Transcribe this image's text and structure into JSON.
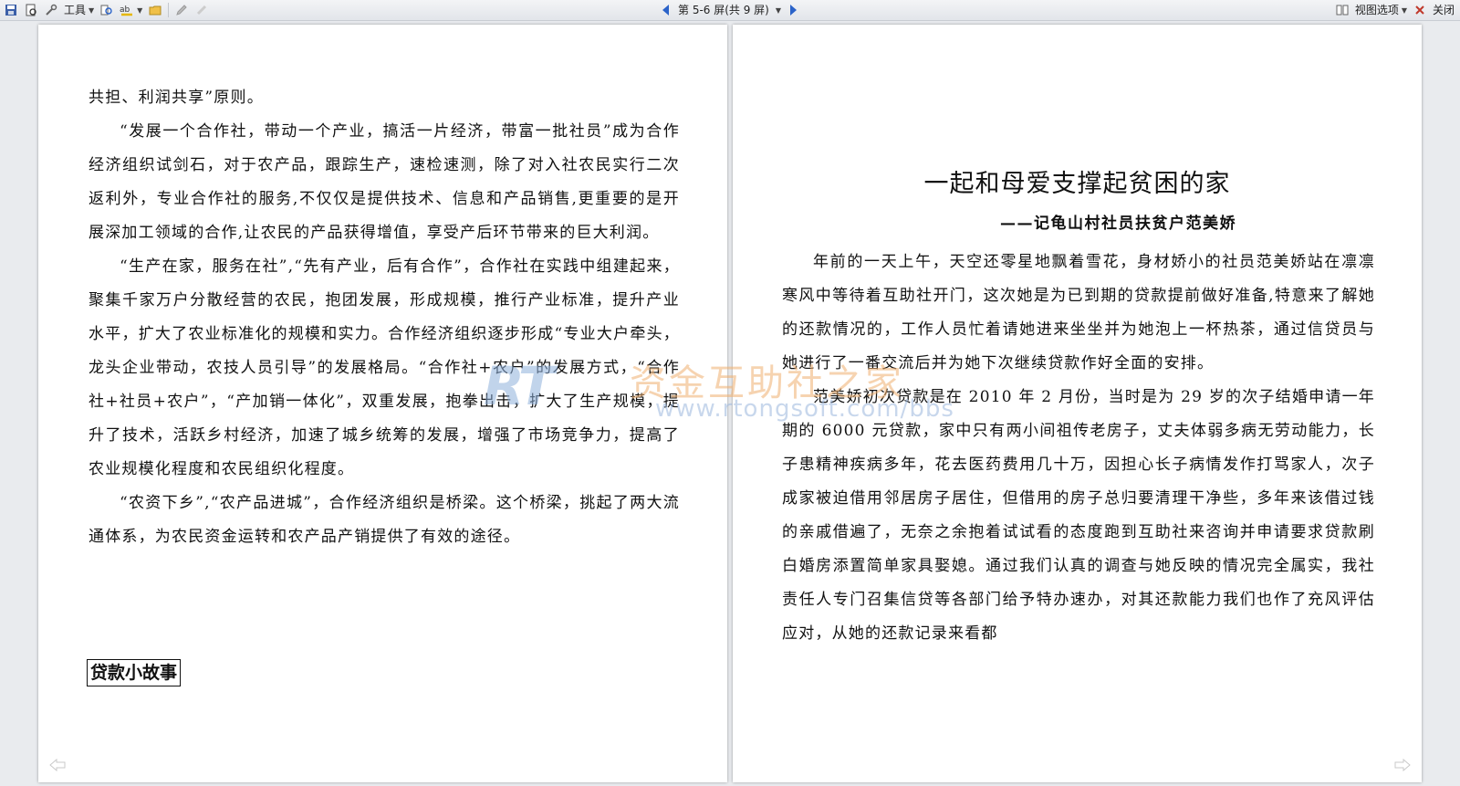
{
  "toolbar": {
    "tools_label": "工具",
    "page_indicator": "第 5-6 屏(共 9 屏)",
    "view_options_label": "视图选项",
    "close_label": "关闭"
  },
  "left_page": {
    "paragraphs": [
      "共担、利润共享”原则。",
      "“发展一个合作社，带动一个产业，搞活一片经济，带富一批社员”成为合作经济组织试剑石，对于农产品，跟踪生产，速检速测，除了对入社农民实行二次返利外，专业合作社的服务,不仅仅是提供技术、信息和产品销售,更重要的是开展深加工领域的合作,让农民的产品获得增值，享受产后环节带来的巨大利润。",
      "“生产在家，服务在社”,“先有产业，后有合作”，合作社在实践中组建起来，聚集千家万户分散经营的农民，抱团发展，形成规模，推行产业标准，提升产业水平，扩大了农业标准化的规模和实力。合作经济组织逐步形成“专业大户牵头，龙头企业带动，农技人员引导”的发展格局。“合作社+农户”的发展方式，“合作社+社员+农户”，“产加销一体化”，双重发展，抱拳出击，扩大了生产规模，提升了技术，活跃乡村经济，加速了城乡统筹的发展，增强了市场竞争力，提高了农业规模化程度和农民组织化程度。",
      "“农资下乡”,“农产品进城”，合作经济组织是桥梁。这个桥梁，挑起了两大流通体系，为农民资金运转和农产品产销提供了有效的途径。"
    ],
    "section_heading": "贷款小故事"
  },
  "right_page": {
    "title": "一起和母爱支撑起贫困的家",
    "subtitle": "——记龟山村社员扶贫户范美娇",
    "paragraphs": [
      "年前的一天上午，天空还零星地飘着雪花，身材娇小的社员范美娇站在凛凛寒风中等待着互助社开门，这次她是为已到期的贷款提前做好准备,特意来了解她的还款情况的，工作人员忙着请她进来坐坐并为她泡上一杯热茶，通过信贷员与她进行了一番交流后并为她下次继续贷款作好全面的安排。",
      "范美娇初次贷款是在 2010 年 2 月份，当时是为 29 岁的次子结婚申请一年期的 6000 元贷款，家中只有两小间祖传老房子，丈夫体弱多病无劳动能力，长子患精神疾病多年，花去医药费用几十万，因担心长子病情发作打骂家人，次子成家被迫借用邻居房子居住，但借用的房子总归要清理干净些，多年来该借过钱的亲戚借遍了，无奈之余抱着试试看的态度跑到互助社来咨询并申请要求贷款刷白婚房添置简单家具娶媳。通过我们认真的调查与她反映的情况完全属实，我社责任人专门召集信贷等各部门给予特办速办，对其还款能力我们也作了充风评估应对，从她的还款记录来看都"
    ]
  },
  "watermark": {
    "logo_text": "RT",
    "cn_text": "资金互助社之家",
    "url_text": "www.rtongsoft.com/bbs"
  },
  "colors": {
    "nav_blue": "#2b63c9",
    "watermark_orange": "#f0b070",
    "watermark_blue": "#8fb1dc"
  }
}
